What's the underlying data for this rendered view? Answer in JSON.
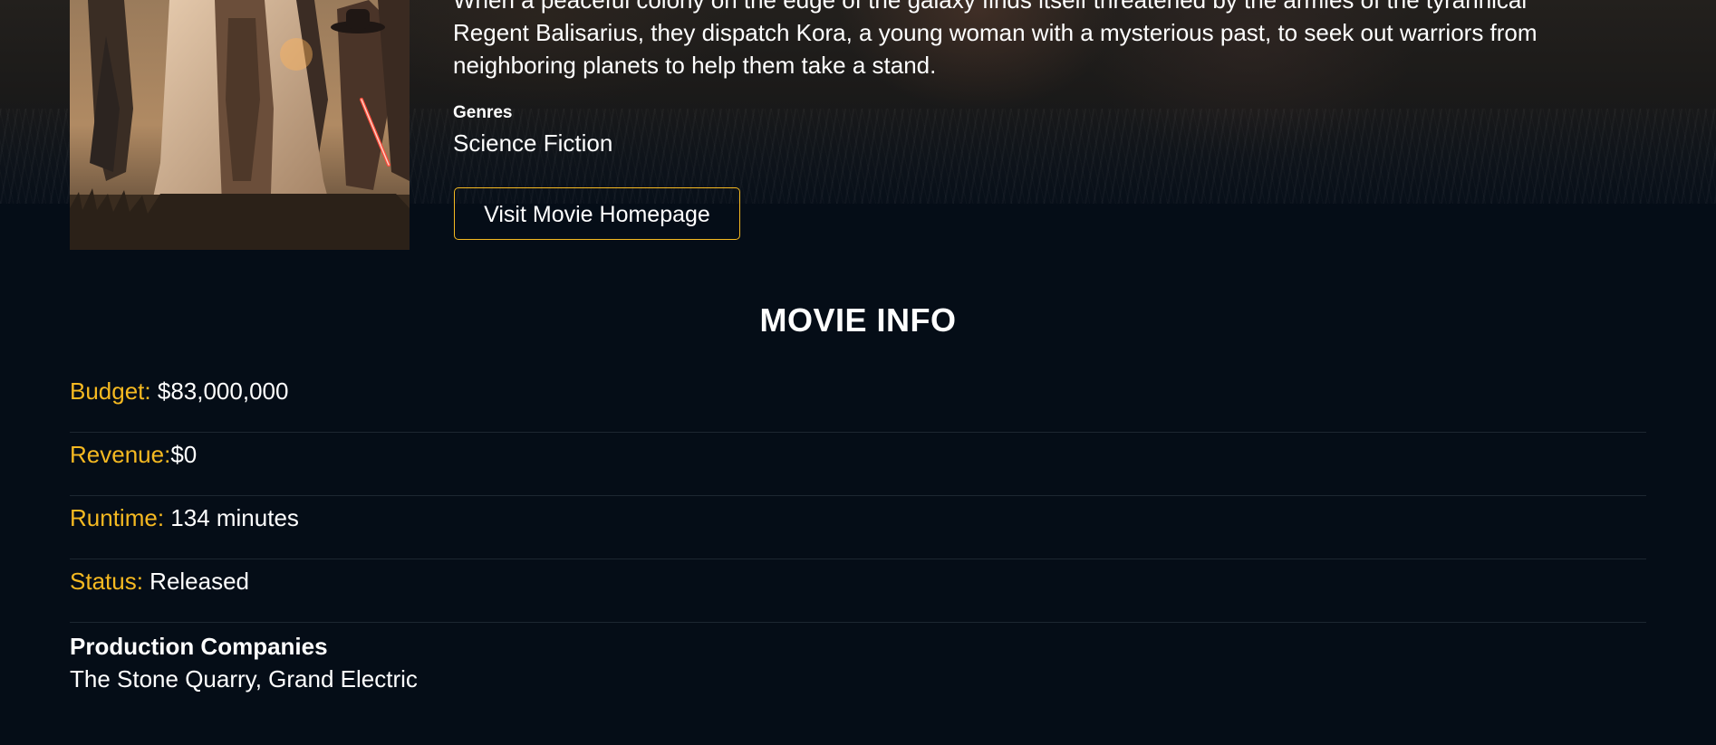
{
  "movie": {
    "overview_line1": "When a peaceful colony on the edge of the galaxy finds itself threatened by the armies of the tyrannical",
    "overview_line2": "Regent Balisarius, they dispatch Kora, a young woman with a mysterious past, to seek out warriors from",
    "overview_line3": "neighboring planets to help them take a stand.",
    "genres_label": "Genres",
    "genres_value": "Science Fiction",
    "homepage_button_label": "Visit Movie Homepage"
  },
  "movie_info": {
    "title": "MOVIE INFO",
    "rows": [
      {
        "label": "Budget:",
        "value": " $83,000,000"
      },
      {
        "label": "Revenue:",
        "value": "$0"
      },
      {
        "label": "Runtime:",
        "value": " 134 minutes"
      },
      {
        "label": "Status:",
        "value": " Released"
      }
    ],
    "production_label": "Production Companies",
    "production_value": "The Stone Quarry, Grand Electric"
  },
  "colors": {
    "background": "#050d17",
    "accent": "#f5b921",
    "text": "#ffffff",
    "divider": "#1d2731"
  },
  "icons": {
    "poster": "movie-poster-image"
  }
}
